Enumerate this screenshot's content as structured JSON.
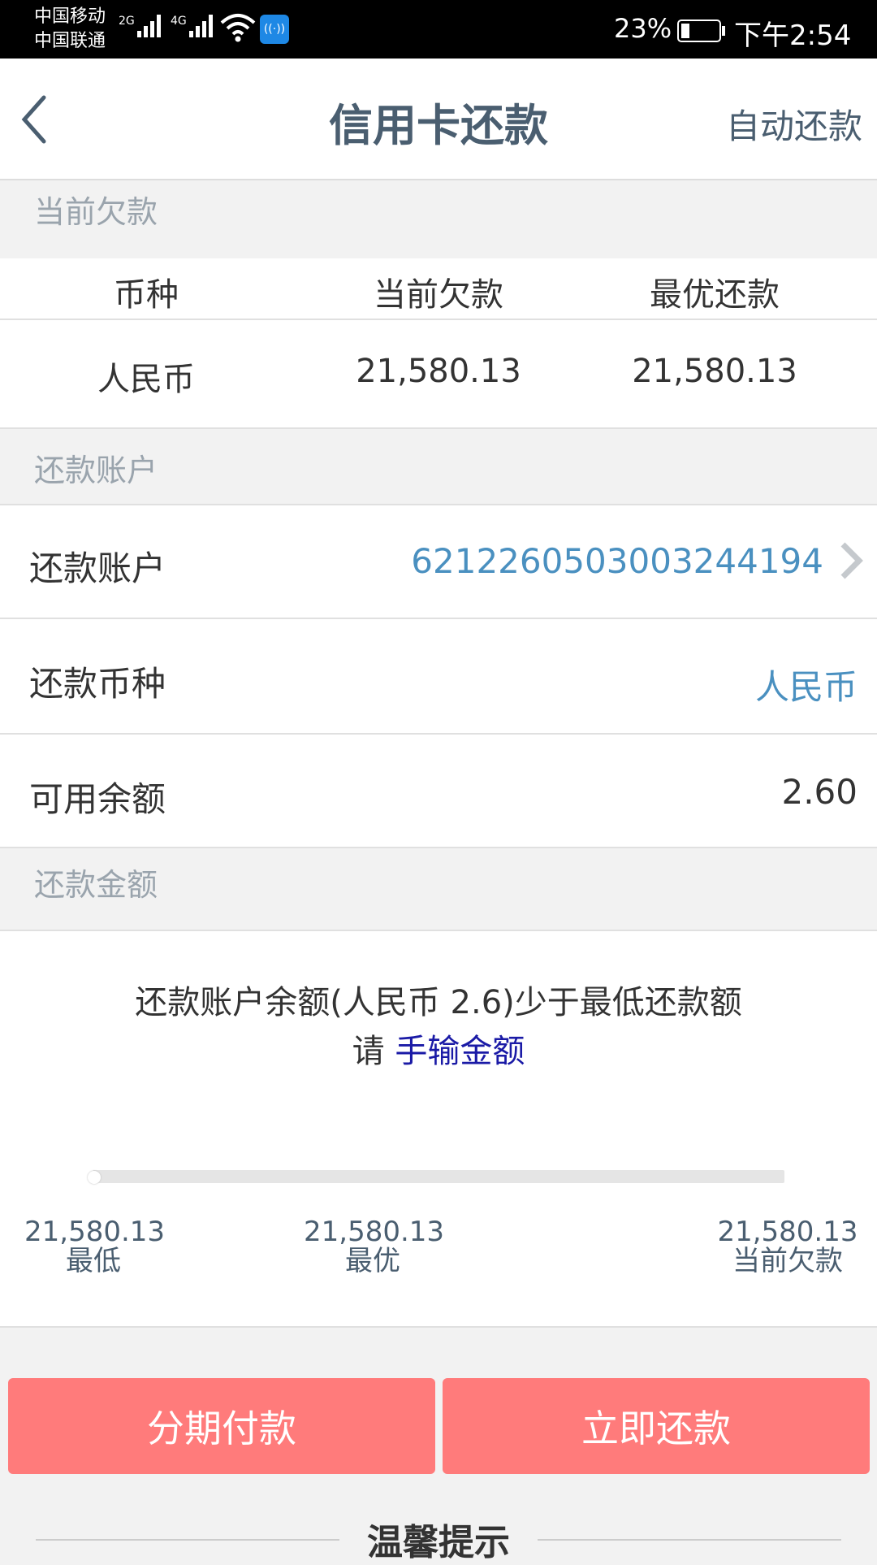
{
  "status_bar": {
    "carrier1": "中国移动",
    "carrier2": "中国联通",
    "net1": "2G",
    "net2": "4G",
    "battery": "23%",
    "time": "下午2:54"
  },
  "nav": {
    "title": "信用卡还款",
    "action": "自动还款"
  },
  "debt_section": {
    "header": "当前欠款",
    "columns": [
      "币种",
      "当前欠款",
      "最优还款"
    ],
    "row": [
      "人民币",
      "21,580.13",
      "21,580.13"
    ]
  },
  "account_section": {
    "header": "还款账户",
    "rows": [
      {
        "label": "还款账户",
        "value": "6212260503003244194"
      },
      {
        "label": "还款币种",
        "value": "人民币"
      },
      {
        "label": "可用余额",
        "value": "2.60"
      }
    ]
  },
  "amount_section": {
    "header": "还款金额",
    "notice_line1": "还款账户余额(人民币 2.6)少于最低还款额",
    "notice_prefix": "请",
    "notice_link": "手输金额",
    "slider_value": 0,
    "ticks": [
      {
        "value": "21,580.13",
        "label": "最低"
      },
      {
        "value": "21,580.13",
        "label": "最优"
      },
      {
        "value": "21,580.13",
        "label": "当前欠款"
      }
    ]
  },
  "buttons": {
    "installment": "分期付款",
    "repay_now": "立即还款"
  },
  "tips": {
    "title": "温馨提示"
  },
  "colors": {
    "button": "#ff7b7b",
    "link_blue": "#4a90c0",
    "nav_text": "#4a5e70"
  }
}
